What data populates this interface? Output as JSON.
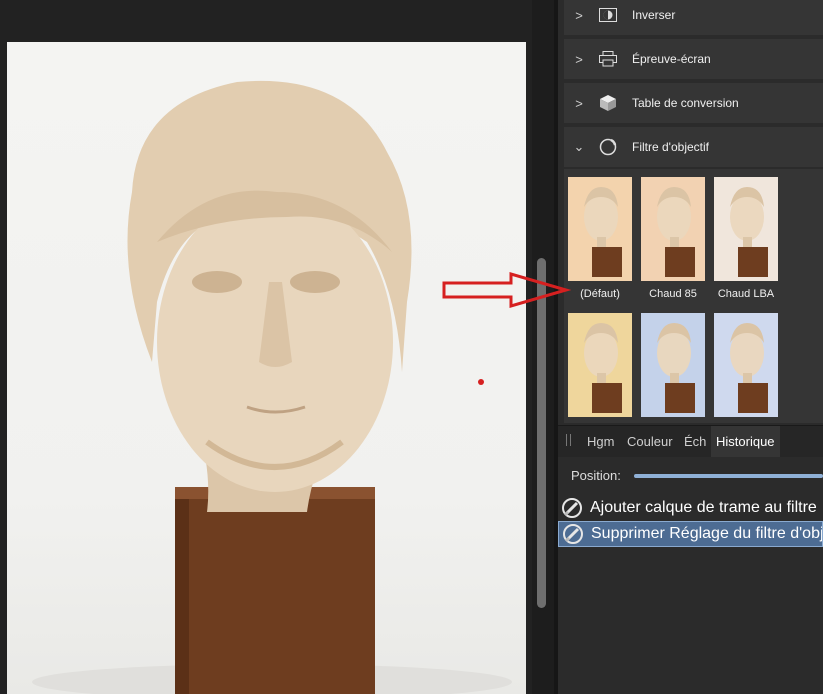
{
  "adjustments": [
    {
      "label": "Inverser",
      "icon": "invert-icon",
      "chevron": ">"
    },
    {
      "label": "Épreuve-écran",
      "icon": "printer-icon",
      "chevron": ">"
    },
    {
      "label": "Table de conversion",
      "icon": "cube-icon",
      "chevron": ">"
    }
  ],
  "lens_filter": {
    "label": "Filtre d'objectif",
    "icon": "lens-icon",
    "chevron": "⌄",
    "presets": [
      {
        "label": "(Défaut)",
        "tint": "#f3d3ad"
      },
      {
        "label": "Chaud 85",
        "tint": "#f2d2b2"
      },
      {
        "label": "Chaud LBA",
        "tint": "#f0e6dc"
      },
      {
        "label": "",
        "tint": "#efd69c"
      },
      {
        "label": "",
        "tint": "#c4d2ea"
      },
      {
        "label": "",
        "tint": "#cfd9ee"
      }
    ]
  },
  "tabs": [
    {
      "label": "Hgm",
      "active": false
    },
    {
      "label": "Couleur",
      "active": false
    },
    {
      "label": "Éch",
      "active": false
    },
    {
      "label": "Historique",
      "active": true
    }
  ],
  "history": {
    "position_label": "Position:",
    "entries": [
      {
        "label": "Ajouter calque de trame au filtre",
        "selected": false
      },
      {
        "label": "Supprimer Réglage du filtre d'objectif",
        "selected": true
      }
    ]
  },
  "colors": {
    "annotation": "#d62020",
    "selection": "#4d6c93"
  }
}
